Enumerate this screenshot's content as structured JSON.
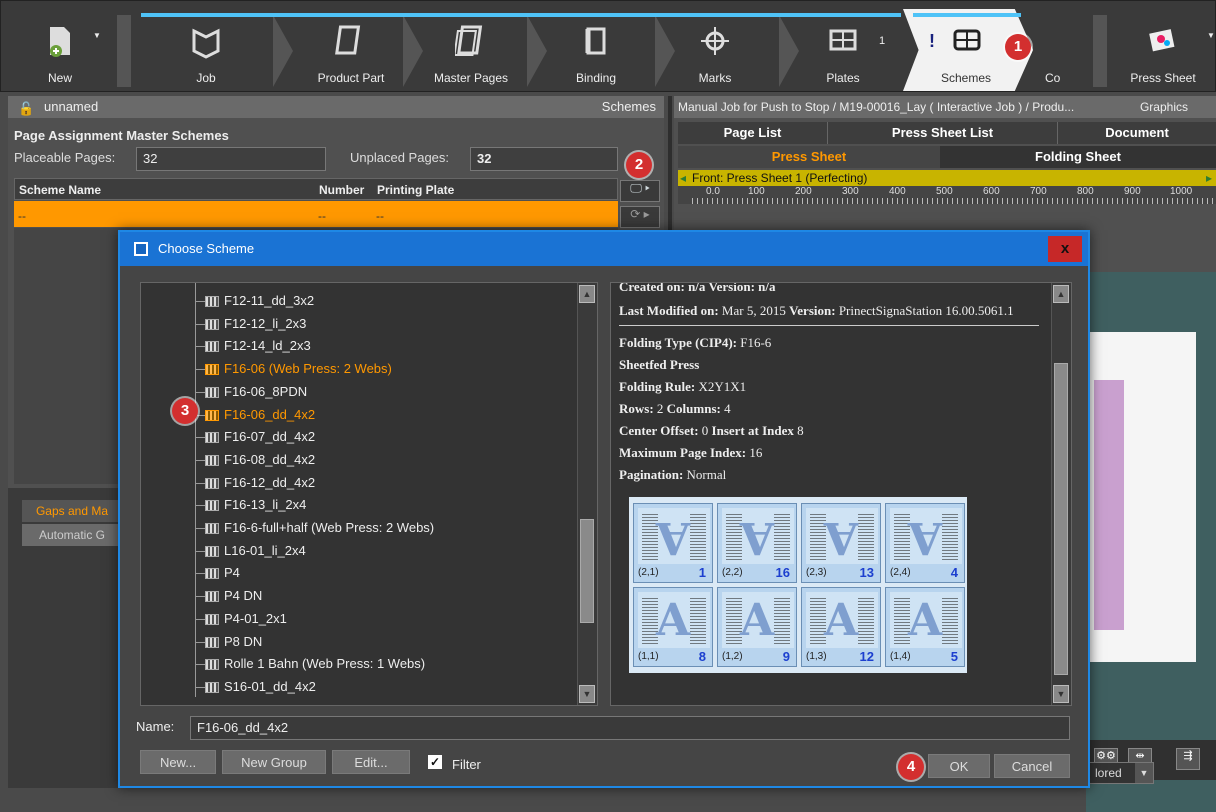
{
  "workflow": {
    "steps": [
      {
        "label": "New",
        "icon": "new-job-icon"
      },
      {
        "label": "Job",
        "icon": "job-book-icon"
      },
      {
        "label": "Product Part",
        "icon": "product-part-icon"
      },
      {
        "label": "Master Pages",
        "icon": "master-pages-icon"
      },
      {
        "label": "Binding",
        "icon": "binding-icon"
      },
      {
        "label": "Marks",
        "icon": "marks-icon"
      },
      {
        "label": "Plates",
        "icon": "plates-icon",
        "count": "1"
      },
      {
        "label": "Schemes",
        "icon": "schemes-icon"
      },
      {
        "label": "Co",
        "icon": ""
      },
      {
        "label": "Press Sheet",
        "icon": "press-sheet-icon"
      }
    ]
  },
  "badges": {
    "b1": "1",
    "b2": "2",
    "b3": "3",
    "b4": "4"
  },
  "left": {
    "header_title": "unnamed",
    "header_right": "Schemes",
    "section_title": "Page Assignment  Master Schemes",
    "placeable_label": "Placeable Pages:",
    "placeable_value": "32",
    "unplaced_label": "Unplaced Pages:",
    "unplaced_value": "32",
    "columns": [
      "Scheme Name",
      "Number",
      "Printing Plate"
    ],
    "row": [
      "--",
      "--",
      "--"
    ],
    "gaps_tab": "Gaps and Ma",
    "auto_tab": "Automatic G"
  },
  "right": {
    "header_title": "Manual Job for Push to Stop / M19-00016_Lay ( Interactive Job ) / Produ...",
    "header_tab": "Graphics",
    "tabs": [
      "Page List",
      "Press Sheet List",
      "Document"
    ],
    "subtabs": [
      "Press Sheet",
      "Folding Sheet"
    ],
    "front_label": "Front:  Press Sheet 1 (Perfecting)",
    "ruler": [
      "0.0",
      "100",
      "200",
      "300",
      "400",
      "500",
      "600",
      "700",
      "800",
      "900",
      "1000"
    ],
    "colored_dropdown": "lored"
  },
  "dialog": {
    "title": "Choose Scheme",
    "close": "x",
    "tree_items": [
      "F12-11_dd_3x2",
      "F12-12_li_2x3",
      "F12-14_ld_2x3",
      "F16-06 (Web Press: 2 Webs)",
      "F16-06_8PDN",
      "F16-06_dd_4x2",
      "F16-07_dd_4x2",
      "F16-08_dd_4x2",
      "F16-12_dd_4x2",
      "F16-13_li_2x4",
      "F16-6-full+half (Web Press: 2 Webs)",
      "L16-01_li_2x4",
      "P4",
      "P4 DN",
      "P4-01_2x1",
      "P8 DN",
      "Rolle 1 Bahn (Web Press: 1 Webs)",
      "S16-01_dd_4x2"
    ],
    "info": {
      "created": "Created on: n/a  Version: n/a",
      "last_modified_label": "Last Modified on:",
      "last_modified_value": " Mar 5, 2015 ",
      "version_label": "Version:",
      "version_value": " PrinectSignaStation 16.00.5061.1",
      "folding_type_label": "Folding Type (CIP4):",
      "folding_type_value": " F16-6",
      "sheetfed": "Sheetfed Press",
      "folding_rule_label": "Folding Rule:",
      "folding_rule_value": " X2Y1X1",
      "rows_label": "Rows:",
      "rows_value": " 2 ",
      "columns_label": "Columns:",
      "columns_value": " 4",
      "center_label": "Center Offset:",
      "center_value": " 0 ",
      "insert_label": "Insert at Index",
      "insert_value": " 8",
      "max_label": "Maximum Page Index:",
      "max_value": " 16",
      "pagination_label": "Pagination:",
      "pagination_value": " Normal"
    },
    "preview_top": [
      {
        "coord": "(2,1)",
        "num": "1"
      },
      {
        "coord": "(2,2)",
        "num": "16"
      },
      {
        "coord": "(2,3)",
        "num": "13"
      },
      {
        "coord": "(2,4)",
        "num": "4"
      }
    ],
    "preview_bottom": [
      {
        "coord": "(1,1)",
        "num": "8"
      },
      {
        "coord": "(1,2)",
        "num": "9"
      },
      {
        "coord": "(1,3)",
        "num": "12"
      },
      {
        "coord": "(1,4)",
        "num": "5"
      }
    ],
    "name_label": "Name:",
    "name_value": "F16-06_dd_4x2",
    "buttons": {
      "new": "New...",
      "new_group": "New Group",
      "edit": "Edit...",
      "ok": "OK",
      "cancel": "Cancel"
    },
    "filter_label": "Filter",
    "selected_item": "F16-06_dd_4x2"
  },
  "colors": {
    "accent": "#ff9800",
    "dialog_title": "#1a73d4",
    "badge": "#d32f2f",
    "stripe": "#4fc3f7"
  }
}
